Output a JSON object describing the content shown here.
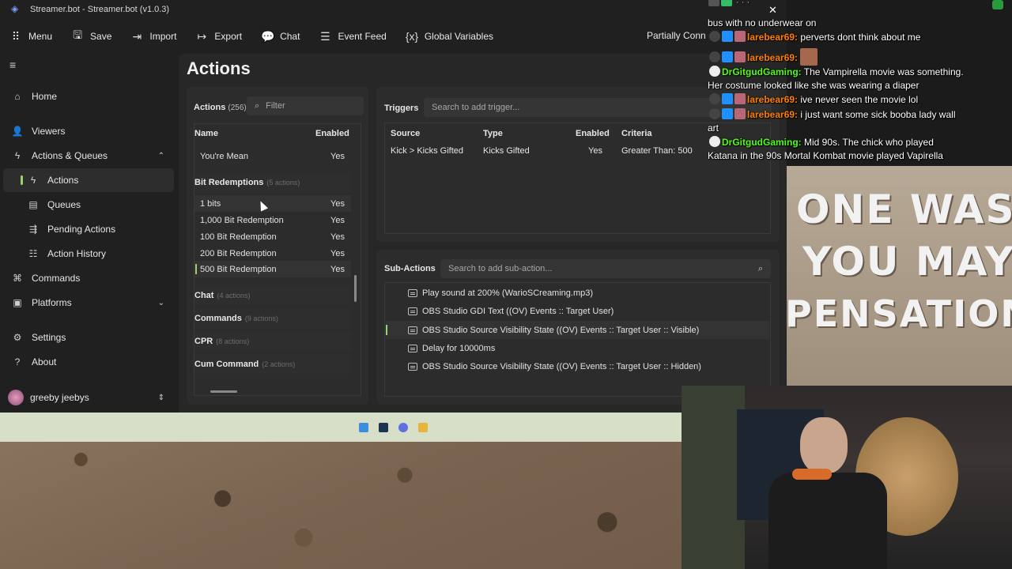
{
  "window": {
    "title": "Streamer.bot - Streamer.bot (v1.0.3)",
    "status": "Partially Conn"
  },
  "toolbar": {
    "menu": "Menu",
    "save": "Save",
    "import": "Import",
    "export": "Export",
    "chat": "Chat",
    "event_feed": "Event Feed",
    "global_variables": "Global Variables"
  },
  "sidebar": {
    "home": "Home",
    "viewers": "Viewers",
    "actions_queues": "Actions & Queues",
    "actions": "Actions",
    "queues": "Queues",
    "pending_actions": "Pending Actions",
    "action_history": "Action History",
    "commands": "Commands",
    "platforms": "Platforms",
    "settings": "Settings",
    "about": "About",
    "user": "greeby jeebys"
  },
  "page": {
    "title": "Actions"
  },
  "actions_panel": {
    "label": "Actions",
    "count": "(256)",
    "filter_placeholder": "Filter",
    "col_name": "Name",
    "col_enabled": "Enabled",
    "rows_top": [
      {
        "name": "You're Mean",
        "enabled": "Yes"
      }
    ],
    "group_bits": {
      "name": "Bit Redemptions",
      "count": "(5 actions)"
    },
    "bit_rows": [
      {
        "name": "1 bits",
        "enabled": "Yes"
      },
      {
        "name": "1,000 Bit Redemption",
        "enabled": "Yes"
      },
      {
        "name": "100 Bit Redemption",
        "enabled": "Yes"
      },
      {
        "name": "200 Bit Redemption",
        "enabled": "Yes"
      },
      {
        "name": "500 Bit Redemption",
        "enabled": "Yes"
      }
    ],
    "groups": [
      {
        "name": "Chat",
        "count": "(4 actions)"
      },
      {
        "name": "Commands",
        "count": "(9 actions)"
      },
      {
        "name": "CPR",
        "count": "(8 actions)"
      },
      {
        "name": "Cum Command",
        "count": "(2 actions)"
      }
    ]
  },
  "triggers": {
    "label": "Triggers",
    "search_placeholder": "Search to add trigger...",
    "columns": [
      "Source",
      "Type",
      "Enabled",
      "Criteria"
    ],
    "rows": [
      {
        "source": "Kick > Kicks Gifted",
        "type": "Kicks Gifted",
        "enabled": "Yes",
        "criteria": "Greater Than: 500"
      }
    ]
  },
  "subactions": {
    "label": "Sub-Actions",
    "search_placeholder": "Search to add sub-action...",
    "rows": [
      "Play sound at 200% (WarioSCreaming.mp3)",
      "OBS Studio GDI Text ((OV) Events :: Target User)",
      "OBS Studio Source Visibility State ((OV) Events :: Target User :: Visible)",
      "Delay for 10000ms",
      "OBS Studio Source Visibility State ((OV) Events :: Target User :: Hidden)"
    ]
  },
  "chat": {
    "m0": "bus with no underwear on",
    "m1_user": "larebear69:",
    "m1_text": "perverts dont think about me",
    "m2_user": "larebear69:",
    "m3_user": "DrGitgudGaming:",
    "m3_text": "The Vampirella movie was something.",
    "m3_cont": "Her costume looked like she was wearing a diaper",
    "m4_user": "larebear69:",
    "m4_text": "ive never seen the movie lol",
    "m5_user": "larebear69:",
    "m5_text": "i just want some sick booba lady wall",
    "m5_cont": "art",
    "m6_user": "DrGitgudGaming:",
    "m6_text": "Mid 90s. The chick who played",
    "m6_cont": "Katana in the 90s Mortal Kombat movie played Vapirella"
  },
  "scene_text": {
    "l1": "ONE WAS",
    "l2": "YOU MAY",
    "l3": "PENSATION"
  },
  "colors": {
    "accent": "#9bd16f",
    "user_green": "#53fc18",
    "user_orange": "#ff7f00"
  }
}
